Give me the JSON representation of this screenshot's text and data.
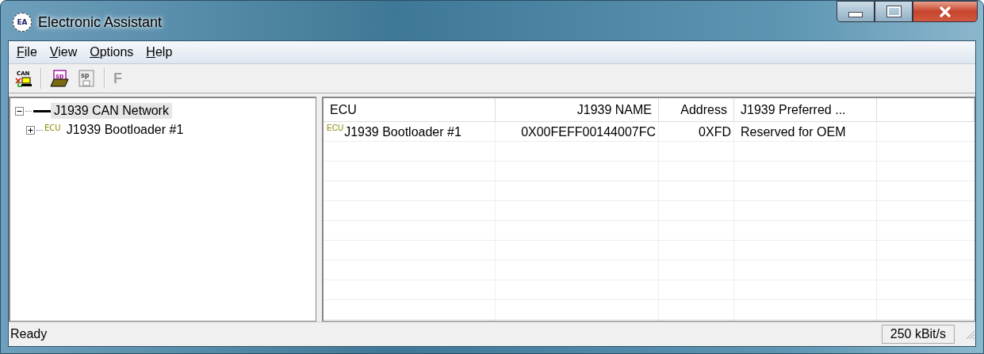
{
  "window": {
    "title": "Electronic Assistant",
    "icon_text": "EA"
  },
  "menu": [
    {
      "label": "File"
    },
    {
      "label": "View"
    },
    {
      "label": "Options"
    },
    {
      "label": "Help"
    }
  ],
  "toolbar": [
    {
      "kind": "can",
      "icon_text": "CAN",
      "disabled": false
    },
    {
      "kind": "separator"
    },
    {
      "kind": "open",
      "icon_text": "sp",
      "disabled": false
    },
    {
      "kind": "save",
      "icon_text": "sp",
      "disabled": true
    },
    {
      "kind": "separator"
    },
    {
      "kind": "letter",
      "label": "F",
      "disabled": true
    }
  ],
  "tree": [
    {
      "label": "J1939 CAN Network",
      "kind": "network",
      "expanded": true,
      "selected": true,
      "children": [
        {
          "label": "J1939 Bootloader #1",
          "kind": "ecu",
          "tag": "ECU",
          "expanded": false,
          "selected": false
        }
      ]
    }
  ],
  "table": {
    "columns": [
      {
        "label": "ECU"
      },
      {
        "label": "J1939 NAME"
      },
      {
        "label": "Address"
      },
      {
        "label": "J1939 Preferred ..."
      }
    ],
    "rows": [
      {
        "tag": "ECU",
        "cells": [
          "J1939 Bootloader #1",
          "0X00FEFF00144007FC",
          "0XFD",
          "Reserved for OEM"
        ]
      }
    ]
  },
  "status_bar": {
    "text": "Ready",
    "bitrate": "250 kBit/s"
  }
}
